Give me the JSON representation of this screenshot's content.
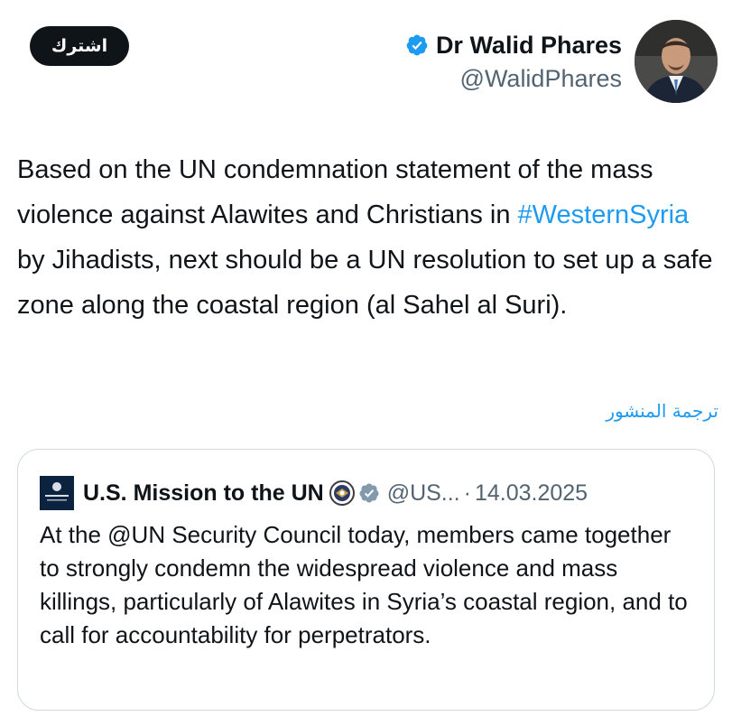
{
  "header": {
    "subscribe_label": "اشترك",
    "author_name": "Dr Walid Phares",
    "author_handle": "@WalidPhares",
    "verified_color": "#1d9bf0"
  },
  "tweet": {
    "text_before": "Based on the UN condemnation statement of the mass violence against Alawites and Christians in ",
    "hashtag": "#WesternSyria",
    "text_after": " by Jihadists, next should be a UN resolution to set up a safe zone along the coastal region (al Sahel al Suri).",
    "translate_label": "ترجمة المنشور"
  },
  "quote": {
    "avatar_line1": "U.S. MISSION",
    "avatar_line2": "United Nations",
    "name": "U.S. Mission to the UN",
    "handle": "@US...",
    "separator": "·",
    "date": "14.03.2025",
    "text": "At the @UN Security Council today, members came together to strongly condemn the widespread violence and mass killings, particularly of Alawites in Syria’s coastal region, and to call for accountability for perpetrators."
  },
  "colors": {
    "link": "#1d9bf0",
    "text": "#0f1419",
    "muted": "#536471",
    "border": "#cfd9de"
  }
}
